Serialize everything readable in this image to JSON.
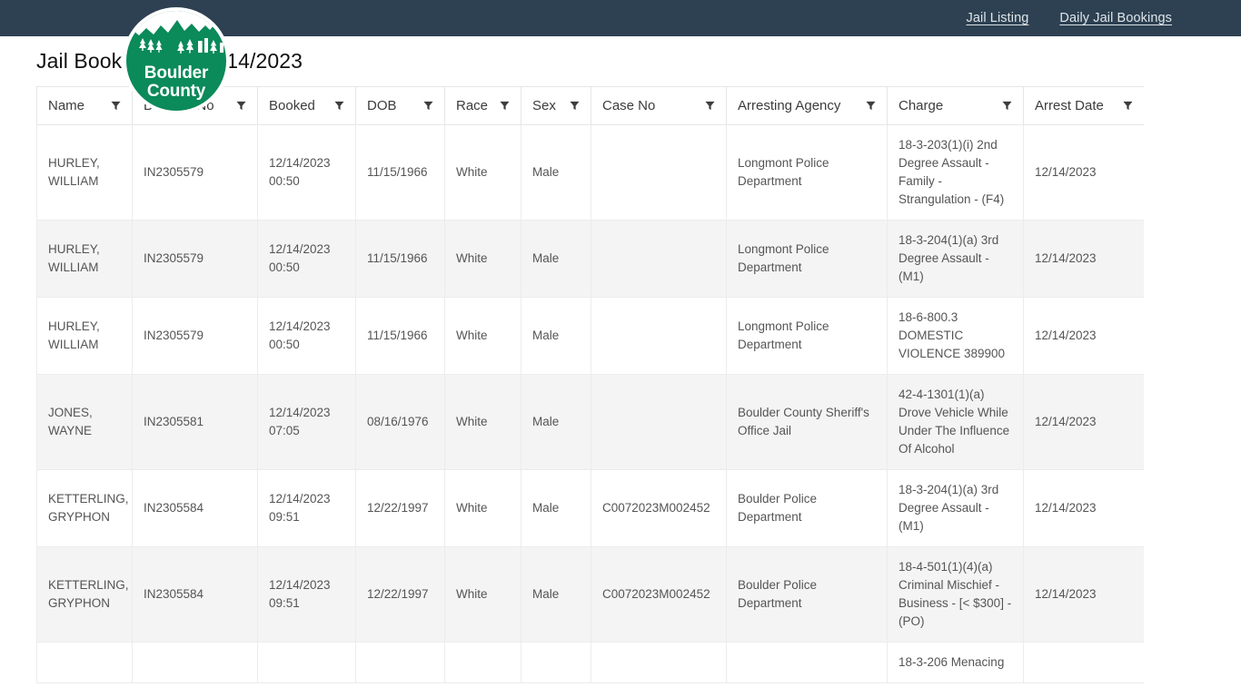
{
  "nav": {
    "links": [
      {
        "label": "Jail Listing",
        "name": "nav-link-jail-listing"
      },
      {
        "label": "Daily Jail Bookings",
        "name": "nav-link-daily-jail-bookings"
      }
    ]
  },
  "logo": {
    "line1": "Boulder",
    "line2": "County",
    "icon": "boulder-county-seal-icon",
    "color": "#0b8a5a"
  },
  "page": {
    "title": "Jail Bookings for 12/14/2023",
    "header_bar_color": "#2d4152",
    "stripe_color": "#f4f4f4"
  },
  "table": {
    "columns": [
      {
        "label": "Name",
        "key": "name"
      },
      {
        "label": "Booking No",
        "key": "booking_no"
      },
      {
        "label": "Booked",
        "key": "booked"
      },
      {
        "label": "DOB",
        "key": "dob"
      },
      {
        "label": "Race",
        "key": "race"
      },
      {
        "label": "Sex",
        "key": "sex"
      },
      {
        "label": "Case No",
        "key": "case_no"
      },
      {
        "label": "Arresting Agency",
        "key": "arresting_agency"
      },
      {
        "label": "Charge",
        "key": "charge"
      },
      {
        "label": "Arrest Date",
        "key": "arrest_date"
      }
    ],
    "filter_icon": "filter-funnel-icon",
    "rows": [
      {
        "name": "HURLEY, WILLIAM",
        "booking_no": "IN2305579",
        "booked": "12/14/2023 00:50",
        "dob": "11/15/1966",
        "race": "White",
        "sex": "Male",
        "case_no": "",
        "arresting_agency": "Longmont Police Department",
        "charge": "18-3-203(1)(i) 2nd Degree Assault - Family - Strangulation - (F4)",
        "arrest_date": "12/14/2023"
      },
      {
        "name": "HURLEY, WILLIAM",
        "booking_no": "IN2305579",
        "booked": "12/14/2023 00:50",
        "dob": "11/15/1966",
        "race": "White",
        "sex": "Male",
        "case_no": "",
        "arresting_agency": "Longmont Police Department",
        "charge": "18-3-204(1)(a) 3rd Degree Assault - (M1)",
        "arrest_date": "12/14/2023"
      },
      {
        "name": "HURLEY, WILLIAM",
        "booking_no": "IN2305579",
        "booked": "12/14/2023 00:50",
        "dob": "11/15/1966",
        "race": "White",
        "sex": "Male",
        "case_no": "",
        "arresting_agency": "Longmont Police Department",
        "charge": "18-6-800.3 DOMESTIC VIOLENCE 389900",
        "arrest_date": "12/14/2023"
      },
      {
        "name": "JONES, WAYNE",
        "booking_no": "IN2305581",
        "booked": "12/14/2023 07:05",
        "dob": "08/16/1976",
        "race": "White",
        "sex": "Male",
        "case_no": "",
        "arresting_agency": "Boulder County Sheriff's Office Jail",
        "charge": "42-4-1301(1)(a) Drove Vehicle While Under The Influence Of Alcohol",
        "arrest_date": "12/14/2023"
      },
      {
        "name": "KETTERLING, GRYPHON",
        "booking_no": "IN2305584",
        "booked": "12/14/2023 09:51",
        "dob": "12/22/1997",
        "race": "White",
        "sex": "Male",
        "case_no": "C0072023M002452",
        "arresting_agency": "Boulder Police Department",
        "charge": "18-3-204(1)(a) 3rd Degree Assault - (M1)",
        "arrest_date": "12/14/2023"
      },
      {
        "name": "KETTERLING, GRYPHON",
        "booking_no": "IN2305584",
        "booked": "12/14/2023 09:51",
        "dob": "12/22/1997",
        "race": "White",
        "sex": "Male",
        "case_no": "C0072023M002452",
        "arresting_agency": "Boulder Police Department",
        "charge": "18-4-501(1)(4)(a) Criminal Mischief - Business - [< $300] - (PO)",
        "arrest_date": "12/14/2023"
      },
      {
        "name": "",
        "booking_no": "",
        "booked": "",
        "dob": "",
        "race": "",
        "sex": "",
        "case_no": "",
        "arresting_agency": "",
        "charge": "18-3-206 Menacing",
        "arrest_date": ""
      }
    ]
  }
}
